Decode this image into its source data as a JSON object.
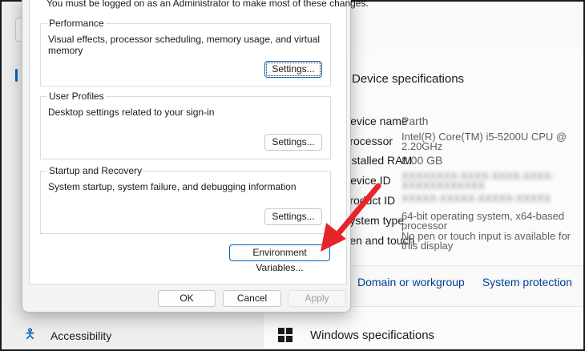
{
  "sidebar": {
    "accessibility": "Accessibility"
  },
  "main": {
    "section_title": "Device specifications",
    "rows": [
      {
        "label": "Device name",
        "value": "Parth"
      },
      {
        "label": "Processor",
        "value": "Intel(R) Core(TM) i5-5200U CPU @ 2.20GHz"
      },
      {
        "label": "Installed RAM",
        "value": "8.00 GB"
      },
      {
        "label": "Device ID",
        "value": "XXXXXXXX-XXXX-XXXX-XXXX-XXXXXXXXXXXX"
      },
      {
        "label": "Product ID",
        "value": "XXXXX-XXXXX-XXXXX-XXXXX"
      },
      {
        "label": "System type",
        "value": "64-bit operating system, x64-based processor"
      },
      {
        "label": "Pen and touch",
        "value": "No pen or touch input is available for this display"
      }
    ],
    "links": [
      "Domain or workgroup",
      "System protection"
    ],
    "windows_spec": "Windows specifications"
  },
  "dialog": {
    "note": "You must be logged on as an Administrator to make most of these changes.",
    "groups": [
      {
        "title": "Performance",
        "desc": "Visual effects, processor scheduling, memory usage, and virtual memory",
        "button": "Settings..."
      },
      {
        "title": "User Profiles",
        "desc": "Desktop settings related to your sign-in",
        "button": "Settings..."
      },
      {
        "title": "Startup and Recovery",
        "desc": "System startup, system failure, and debugging information",
        "button": "Settings..."
      }
    ],
    "env_button": "Environment Variables...",
    "ok": "OK",
    "cancel": "Cancel",
    "apply": "Apply"
  },
  "colors": {
    "accent": "#0067c0",
    "arrow": "#e8242b"
  }
}
